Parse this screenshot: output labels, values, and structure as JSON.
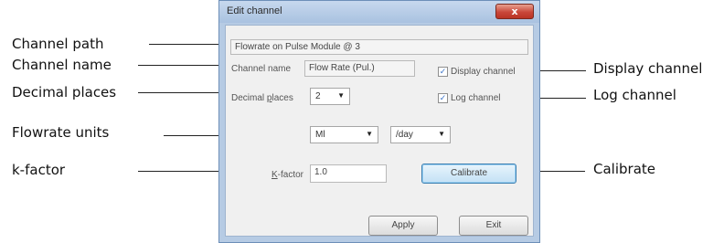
{
  "callouts": {
    "channel_path": "Channel path",
    "channel_name": "Channel name",
    "decimal_places": "Decimal places",
    "flowrate_units": "Flowrate units",
    "k_factor": "k-factor",
    "display_channel": "Display channel",
    "log_channel": "Log channel",
    "calibrate": "Calibrate"
  },
  "dialog": {
    "title": "Edit channel",
    "close_label": "x",
    "channel_path_value": "Flowrate on Pulse Module @ 3",
    "channel_name_label": "Channel name",
    "channel_name_value": "Flow Rate (Pul.)",
    "display_channel_label": "Display channel",
    "display_channel_checked": true,
    "log_channel_label": "Log channel",
    "log_channel_checked": true,
    "decimal_places_label_pre": "Decimal ",
    "decimal_places_label_key": "p",
    "decimal_places_label_post": "laces",
    "decimal_places_value": "2",
    "flow_unit_value": "Ml",
    "time_unit_value": "/day",
    "k_factor_label_key": "K",
    "k_factor_label_post": "-factor",
    "k_factor_value": "1.0",
    "calibrate_label": "Calibrate",
    "apply_label": "Apply",
    "exit_label": "Exit",
    "check_mark": "✓",
    "combo_arrow": "▼"
  }
}
